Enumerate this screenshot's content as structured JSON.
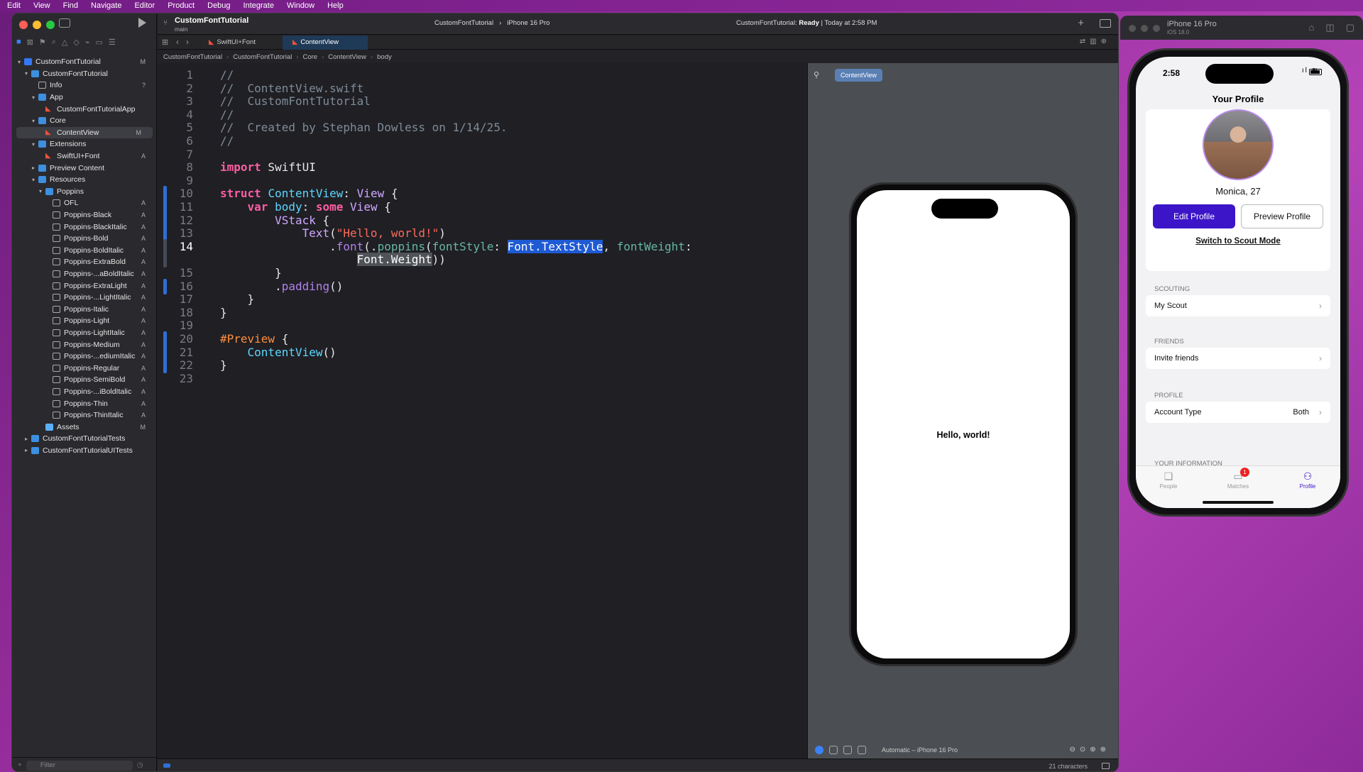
{
  "menubar": [
    "Edit",
    "View",
    "Find",
    "Navigate",
    "Editor",
    "Product",
    "Debug",
    "Integrate",
    "Window",
    "Help"
  ],
  "toolbar": {
    "project": "CustomFontTutorial",
    "branch": "main",
    "scheme": "CustomFontTutorial",
    "device": "iPhone 16 Pro",
    "status_prefix": "CustomFontTutorial: ",
    "status_state": "Ready",
    "status_time": " | Today at 2:58 PM"
  },
  "tabs": [
    {
      "label": "SwiftUI+Font"
    },
    {
      "label": "ContentView"
    }
  ],
  "breadcrumb": [
    "CustomFontTutorial",
    "CustomFontTutorial",
    "Core",
    "ContentView",
    "body"
  ],
  "tree": [
    {
      "label": "CustomFontTutorial",
      "depth": 0,
      "chev": "v",
      "icon": "proj",
      "badge": "M"
    },
    {
      "label": "CustomFontTutorial",
      "depth": 1,
      "chev": "v",
      "icon": "folder",
      "badge": ""
    },
    {
      "label": "Info",
      "depth": 2,
      "chev": "",
      "icon": "doc",
      "badge": "?"
    },
    {
      "label": "App",
      "depth": 2,
      "chev": "v",
      "icon": "folder",
      "badge": ""
    },
    {
      "label": "CustomFontTutorialApp",
      "depth": 3,
      "chev": "",
      "icon": "swift",
      "badge": ""
    },
    {
      "label": "Core",
      "depth": 2,
      "chev": "v",
      "icon": "folder",
      "badge": ""
    },
    {
      "label": "ContentView",
      "depth": 3,
      "chev": "",
      "icon": "swift",
      "badge": "M",
      "selected": true
    },
    {
      "label": "Extensions",
      "depth": 2,
      "chev": "v",
      "icon": "folder",
      "badge": ""
    },
    {
      "label": "SwiftUI+Font",
      "depth": 3,
      "chev": "",
      "icon": "swift",
      "badge": "A"
    },
    {
      "label": "Preview Content",
      "depth": 2,
      "chev": ">",
      "icon": "folder",
      "badge": ""
    },
    {
      "label": "Resources",
      "depth": 2,
      "chev": "v",
      "icon": "folder",
      "badge": ""
    },
    {
      "label": "Poppins",
      "depth": 3,
      "chev": "v",
      "icon": "folder",
      "badge": ""
    },
    {
      "label": "OFL",
      "depth": 4,
      "chev": "",
      "icon": "doc",
      "badge": "A"
    },
    {
      "label": "Poppins-Black",
      "depth": 4,
      "chev": "",
      "icon": "doc",
      "badge": "A"
    },
    {
      "label": "Poppins-BlackItalic",
      "depth": 4,
      "chev": "",
      "icon": "doc",
      "badge": "A"
    },
    {
      "label": "Poppins-Bold",
      "depth": 4,
      "chev": "",
      "icon": "doc",
      "badge": "A"
    },
    {
      "label": "Poppins-BoldItalic",
      "depth": 4,
      "chev": "",
      "icon": "doc",
      "badge": "A"
    },
    {
      "label": "Poppins-ExtraBold",
      "depth": 4,
      "chev": "",
      "icon": "doc",
      "badge": "A"
    },
    {
      "label": "Poppins-...aBoldItalic",
      "depth": 4,
      "chev": "",
      "icon": "doc",
      "badge": "A"
    },
    {
      "label": "Poppins-ExtraLight",
      "depth": 4,
      "chev": "",
      "icon": "doc",
      "badge": "A"
    },
    {
      "label": "Poppins-...LightItalic",
      "depth": 4,
      "chev": "",
      "icon": "doc",
      "badge": "A"
    },
    {
      "label": "Poppins-Italic",
      "depth": 4,
      "chev": "",
      "icon": "doc",
      "badge": "A"
    },
    {
      "label": "Poppins-Light",
      "depth": 4,
      "chev": "",
      "icon": "doc",
      "badge": "A"
    },
    {
      "label": "Poppins-LightItalic",
      "depth": 4,
      "chev": "",
      "icon": "doc",
      "badge": "A"
    },
    {
      "label": "Poppins-Medium",
      "depth": 4,
      "chev": "",
      "icon": "doc",
      "badge": "A"
    },
    {
      "label": "Poppins-...ediumItalic",
      "depth": 4,
      "chev": "",
      "icon": "doc",
      "badge": "A"
    },
    {
      "label": "Poppins-Regular",
      "depth": 4,
      "chev": "",
      "icon": "doc",
      "badge": "A"
    },
    {
      "label": "Poppins-SemiBold",
      "depth": 4,
      "chev": "",
      "icon": "doc",
      "badge": "A"
    },
    {
      "label": "Poppins-...iBoldItalic",
      "depth": 4,
      "chev": "",
      "icon": "doc",
      "badge": "A"
    },
    {
      "label": "Poppins-Thin",
      "depth": 4,
      "chev": "",
      "icon": "doc",
      "badge": "A"
    },
    {
      "label": "Poppins-ThinItalic",
      "depth": 4,
      "chev": "",
      "icon": "doc",
      "badge": "A"
    },
    {
      "label": "Assets",
      "depth": 3,
      "chev": "",
      "icon": "assets",
      "badge": "M"
    },
    {
      "label": "CustomFontTutorialTests",
      "depth": 1,
      "chev": ">",
      "icon": "folder",
      "badge": ""
    },
    {
      "label": "CustomFontTutorialUITests",
      "depth": 1,
      "chev": ">",
      "icon": "folder",
      "badge": ""
    }
  ],
  "filter_placeholder": "Filter",
  "code_lines": [
    {
      "n": "1",
      "parts": [
        [
          "c-com",
          "//"
        ]
      ]
    },
    {
      "n": "2",
      "parts": [
        [
          "c-com",
          "//  ContentView.swift"
        ]
      ]
    },
    {
      "n": "3",
      "parts": [
        [
          "c-com",
          "//  CustomFontTutorial"
        ]
      ]
    },
    {
      "n": "4",
      "parts": [
        [
          "c-com",
          "//"
        ]
      ]
    },
    {
      "n": "5",
      "parts": [
        [
          "c-com",
          "//  Created by Stephan Dowless on 1/14/25."
        ]
      ]
    },
    {
      "n": "6",
      "parts": [
        [
          "c-com",
          "//"
        ]
      ]
    },
    {
      "n": "7",
      "parts": []
    },
    {
      "n": "8",
      "parts": [
        [
          "c-kw",
          "import"
        ],
        [
          "",
          " SwiftUI"
        ]
      ]
    },
    {
      "n": "9",
      "parts": []
    },
    {
      "n": "10",
      "change": true,
      "parts": [
        [
          "c-kw",
          "struct"
        ],
        [
          "",
          " "
        ],
        [
          "c-ty",
          "ContentView"
        ],
        [
          "",
          ": "
        ],
        [
          "c-ty2",
          "View"
        ],
        [
          "",
          " {"
        ]
      ]
    },
    {
      "n": "11",
      "change": true,
      "parts": [
        [
          "",
          "    "
        ],
        [
          "c-kw",
          "var"
        ],
        [
          "",
          " "
        ],
        [
          "c-ty",
          "body"
        ],
        [
          "",
          ": "
        ],
        [
          "c-kw",
          "some"
        ],
        [
          "",
          " "
        ],
        [
          "c-ty2",
          "View"
        ],
        [
          "",
          " {"
        ]
      ]
    },
    {
      "n": "12",
      "change": true,
      "parts": [
        [
          "",
          "        "
        ],
        [
          "c-ty2",
          "VStack"
        ],
        [
          "",
          " {"
        ]
      ]
    },
    {
      "n": "13",
      "change": true,
      "parts": [
        [
          "",
          "            "
        ],
        [
          "c-ty2",
          "Text"
        ],
        [
          "",
          "("
        ],
        [
          "c-str",
          "\"Hello, world!\""
        ],
        [
          "",
          ")"
        ]
      ]
    },
    {
      "n": "14",
      "current": true,
      "gray": true,
      "parts": [
        [
          "",
          "                ."
        ],
        [
          "c-pur",
          "font"
        ],
        [
          "",
          "(."
        ],
        [
          "c-fn",
          "poppins"
        ],
        [
          "",
          "("
        ],
        [
          "c-fn",
          "fontStyle"
        ],
        [
          "",
          ": "
        ],
        [
          "c-sel",
          "Font.TextStyle"
        ],
        [
          "",
          ", "
        ],
        [
          "c-fn",
          "fontWeight"
        ],
        [
          "",
          ":"
        ]
      ]
    },
    {
      "n": "",
      "gray": true,
      "parts": [
        [
          "",
          "                    "
        ],
        [
          "c-sel2",
          "Font.Weight"
        ],
        [
          "",
          "))"
        ]
      ]
    },
    {
      "n": "15",
      "parts": [
        [
          "",
          "        }"
        ]
      ]
    },
    {
      "n": "16",
      "change": true,
      "parts": [
        [
          "",
          "        ."
        ],
        [
          "c-pur",
          "padding"
        ],
        [
          "",
          "()"
        ]
      ]
    },
    {
      "n": "17",
      "parts": [
        [
          "",
          "    }"
        ]
      ]
    },
    {
      "n": "18",
      "parts": [
        [
          "",
          "}"
        ]
      ]
    },
    {
      "n": "19",
      "parts": []
    },
    {
      "n": "20",
      "change": true,
      "parts": [
        [
          "c-pre",
          "#Preview"
        ],
        [
          "",
          " {"
        ]
      ]
    },
    {
      "n": "21",
      "change": true,
      "parts": [
        [
          "",
          "    "
        ],
        [
          "c-ty",
          "ContentView"
        ],
        [
          "",
          "()"
        ]
      ]
    },
    {
      "n": "22",
      "change": true,
      "parts": [
        [
          "",
          "}"
        ]
      ]
    },
    {
      "n": "23",
      "parts": []
    }
  ],
  "canvas": {
    "chip": "ContentView",
    "hello": "Hello, world!",
    "device_select": "Automatic – iPhone 16 Pro"
  },
  "status_bottom": {
    "chars": "21 characters"
  },
  "simulator": {
    "name": "iPhone 16 Pro",
    "os": "iOS 18.0",
    "time": "2:58",
    "nav_title": "Your Profile",
    "profile_name": "Monica, 27",
    "edit_btn": "Edit Profile",
    "preview_btn": "Preview Profile",
    "scout_link": "Switch to Scout Mode",
    "sections": [
      {
        "label": "SCOUTING",
        "row": "My Scout",
        "value": ""
      },
      {
        "label": "FRIENDS",
        "row": "Invite friends",
        "value": ""
      },
      {
        "label": "PROFILE",
        "row": "Account Type",
        "value": "Both"
      }
    ],
    "your_info": "YOUR INFORMATION",
    "tabs": [
      {
        "label": "People",
        "icon": "people-icon"
      },
      {
        "label": "Matches",
        "icon": "matches-icon",
        "badge": "1"
      },
      {
        "label": "Profile",
        "icon": "profile-icon",
        "active": true
      }
    ]
  },
  "colors": {
    "accent": "#3c15c9",
    "selection": "#1e5ad4",
    "change_bar": "#2f6fd6"
  }
}
